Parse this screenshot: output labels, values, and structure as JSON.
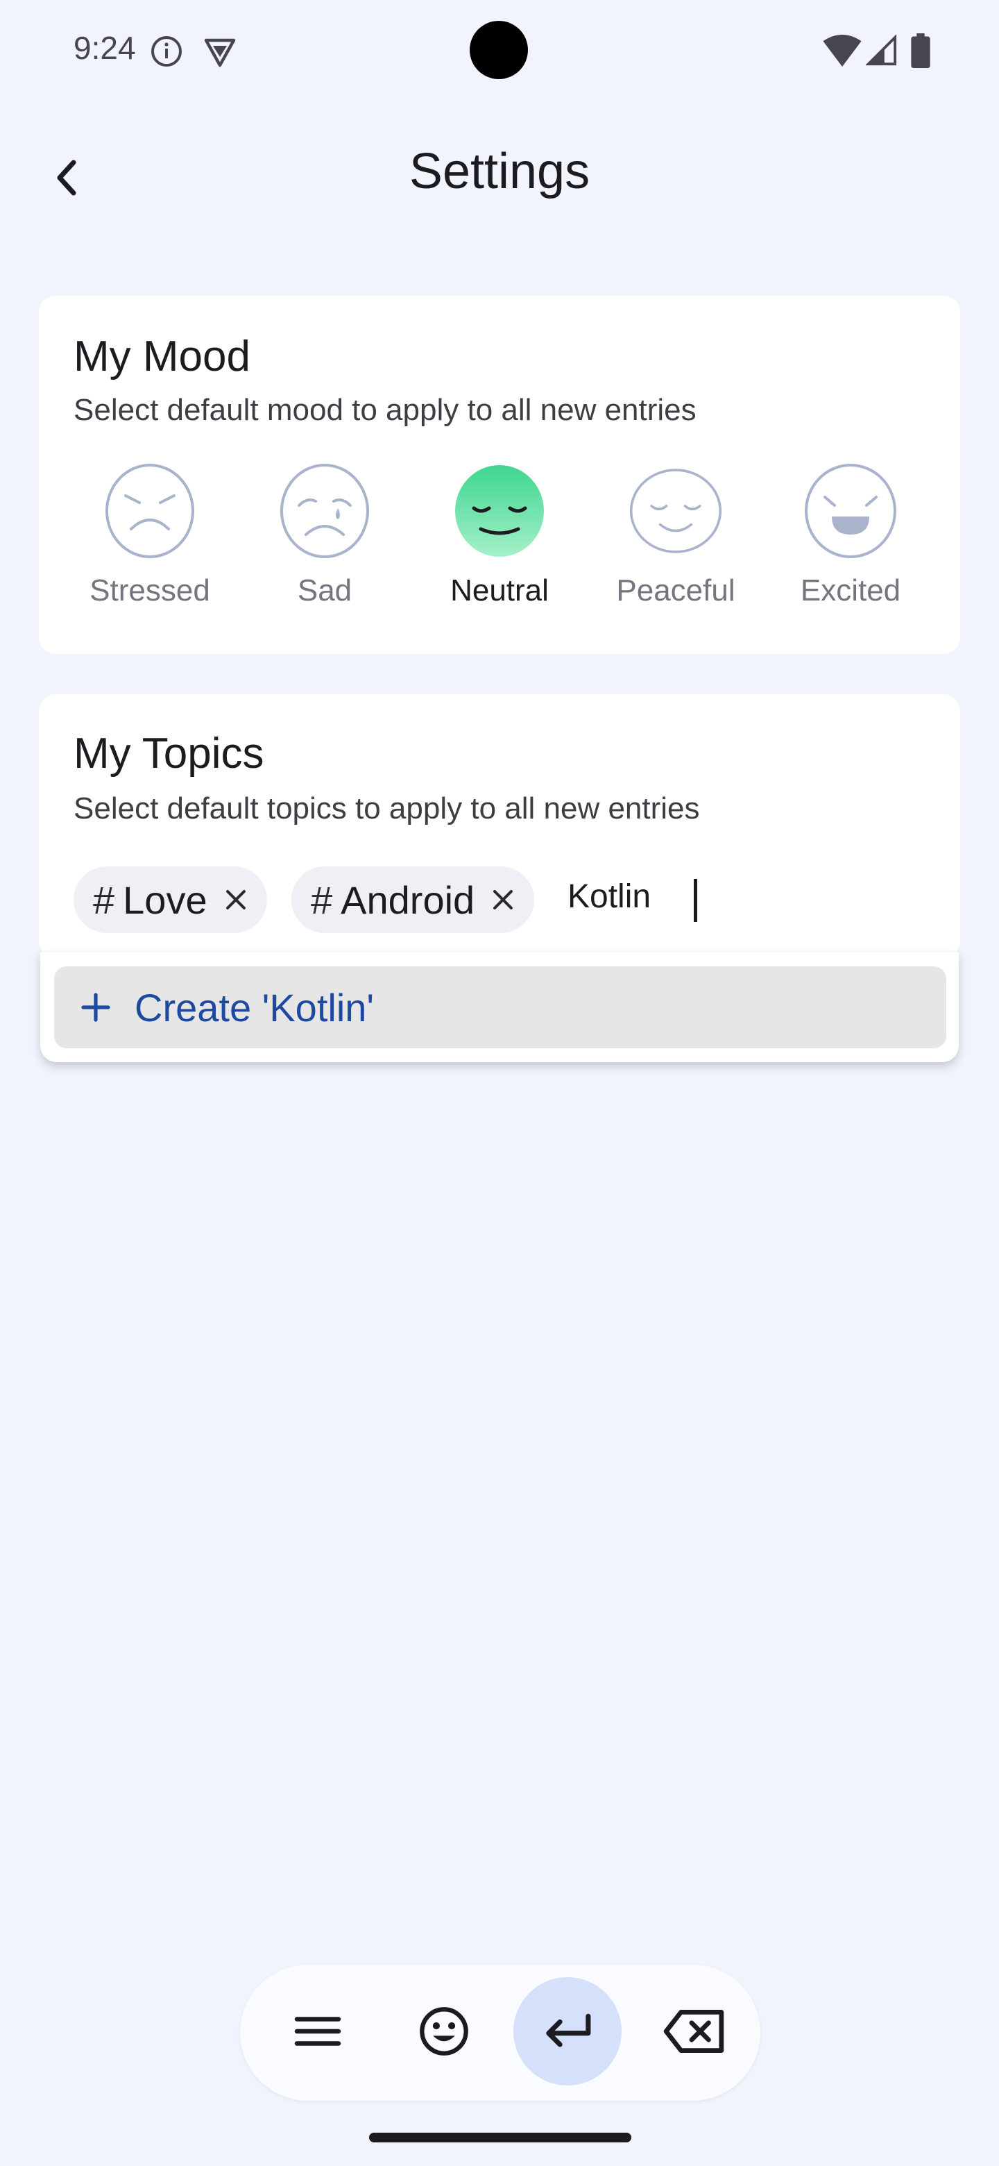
{
  "status_bar": {
    "time": "9:24"
  },
  "header": {
    "title": "Settings"
  },
  "mood_card": {
    "title": "My Mood",
    "subtitle": "Select default mood to apply to all new entries",
    "moods": [
      {
        "label": "Stressed",
        "icon": "stressed-face-icon",
        "selected": false
      },
      {
        "label": "Sad",
        "icon": "sad-face-icon",
        "selected": false
      },
      {
        "label": "Neutral",
        "icon": "neutral-face-icon",
        "selected": true
      },
      {
        "label": "Peaceful",
        "icon": "peaceful-face-icon",
        "selected": false
      },
      {
        "label": "Excited",
        "icon": "excited-face-icon",
        "selected": false
      }
    ]
  },
  "topics_card": {
    "title": "My Topics",
    "subtitle": "Select default topics to apply to all new entries",
    "chips": [
      {
        "hash": "#",
        "label": "Love"
      },
      {
        "hash": "#",
        "label": "Android"
      }
    ],
    "input_value": "Kotlin"
  },
  "dropdown": {
    "create_label": "Create 'Kotlin'"
  },
  "keyboard_toolbar": {
    "buttons": [
      "menu-icon",
      "emoji-icon",
      "enter-icon",
      "backspace-icon"
    ],
    "active": "enter-icon"
  },
  "colors": {
    "background": "#f1f4fd",
    "card": "#ffffff",
    "accent_blue": "#1d4aa0",
    "neutral_green": "#5fe0a3"
  }
}
